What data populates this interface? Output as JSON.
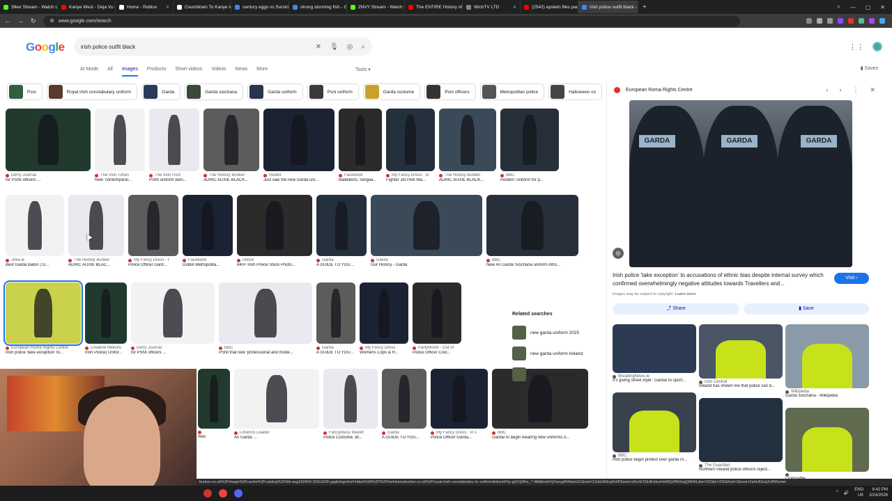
{
  "browser": {
    "tabs": [
      {
        "label": "Slker Stream - Watch Liv",
        "color": "#53fc18"
      },
      {
        "label": "Kanye West - Deja Vu (M",
        "color": "#ff0000"
      },
      {
        "label": "Home - Roblox",
        "color": "#ffffff"
      },
      {
        "label": "Countdown To Kanye We",
        "color": "#ffffff"
      },
      {
        "label": "century eggs vs Surströmi",
        "color": "#4285f4"
      },
      {
        "label": "strong storming fish - Go",
        "color": "#4285f4"
      },
      {
        "label": "2NVY Stream - Watch Liv",
        "color": "#53fc18"
      },
      {
        "label": "The ENTIRE History of Eg",
        "color": "#ff0000"
      },
      {
        "label": "WichTV LTD",
        "color": "#888888"
      },
      {
        "label": "(2542) epstein files paddy",
        "color": "#ff0000"
      },
      {
        "label": "irish police outfit black - ",
        "color": "#4285f4"
      }
    ],
    "new_tab": "+",
    "url": "www.google.com/search"
  },
  "google": {
    "logo": "Google",
    "query": "irish police outfit black",
    "nav_tabs": [
      "AI Mode",
      "All",
      "Images",
      "Products",
      "Short videos",
      "Videos",
      "News",
      "More"
    ],
    "tools": "Tools",
    "saves": "Saves",
    "chips": [
      "Psni",
      "Royal irish constabulary uniform",
      "Garda",
      "Garda siochana",
      "Garda uniform",
      "Psni uniform",
      "Garda costume",
      "Psni officers",
      "Metropolitan police",
      "Halloween co"
    ]
  },
  "results": {
    "row1": [
      {
        "source": "Derry Journal",
        "title": "for PSNI officers ..."
      },
      {
        "source": "The Irish Times",
        "title": "New 'contemporar..."
      },
      {
        "source": "The Irish Post",
        "title": "PSNI uniform bein..."
      },
      {
        "source": "The History Bunker",
        "title": "ADRIC AUXIE BLACK..."
      },
      {
        "source": "Reddit",
        "title": "Just saw the new Garda uni..."
      },
      {
        "source": "Facebook",
        "title": "Bailieboro, Sergea..."
      },
      {
        "source": "My Fancy Dress · In",
        "title": "Fighter Jet Pilot Ma..."
      },
      {
        "source": "The History Bunker",
        "title": "ADRIC AUXIE BLACK..."
      },
      {
        "source": "BBC",
        "title": "modern' uniform for p..."
      }
    ],
    "row2": [
      {
        "source": "Joke.ie",
        "title": "Best Garda Baton | G..."
      },
      {
        "source": "The History Bunker",
        "title": "ADRIC AUXIE BLAC..."
      },
      {
        "source": "My Fancy Dress · I",
        "title": "Police Officer Gard..."
      },
      {
        "source": "Facebook",
        "title": "Dublin Metropolita..."
      },
      {
        "source": "iStock",
        "title": "840+ Irish Police Stock Photo..."
      },
      {
        "source": "Garda",
        "title": "A GUIDE TO YOU..."
      },
      {
        "source": "Garda",
        "title": "Our History - Garda"
      },
      {
        "source": "BBC",
        "title": "New An Garda Síochána uniform intro..."
      }
    ],
    "row3": [
      {
        "source": "European Roma Rights Centre",
        "title": "Irish police 'take exception' to..."
      },
      {
        "source": "Creative Millions",
        "title": "Irish Police) Unifor..."
      },
      {
        "source": "Derry Journal",
        "title": "for PSNI officers ..."
      },
      {
        "source": "BBC",
        "title": "PSNI trial new 'professional and mode..."
      },
      {
        "source": "Garda",
        "title": "A GUIDE TO YOU..."
      },
      {
        "source": "My Fancy Dress",
        "title": "Womens Cops & R..."
      },
      {
        "source": "PartyWorld · Out of",
        "title": "Police Officer Cost..."
      }
    ],
    "row4": [
      {
        "source": "",
        "title": "rbec"
      },
      {
        "source": "Limerick Leader",
        "title": "An Garda ..."
      },
      {
        "source": "Fancydress Wareh",
        "title": "Police Costume, Bl..."
      },
      {
        "source": "Garda",
        "title": "A GUIDE TO YOU..."
      },
      {
        "source": "My Fancy Dress · In s",
        "title": "Police Officer Garda..."
      },
      {
        "source": "BBC",
        "title": "Gardaí to begin wearing new uniforms o..."
      }
    ]
  },
  "related": {
    "heading": "Related searches",
    "items": [
      "new garda uniform 2025",
      "new garda uniform ireland",
      "current garda uniform"
    ]
  },
  "panel": {
    "source": "European Roma Rights Centre",
    "garda_label": "GARDA",
    "caption": "Irish police 'take exception' to accusations of ethnic bias despite internal survey which confirmed overwhelmingly negative attitudes towards Travellers and...",
    "copyright": "Images may be subject to copyright.",
    "learn_more": "Learn more",
    "visit": "Visit",
    "share": "Share",
    "save": "Save",
    "related_images": [
      {
        "source": "BreakingNews.ie",
        "title": "It's giving street style': Gardaí to sport..."
      },
      {
        "source": "Irish Central",
        "title": "Ireland has shown me that police can b..."
      },
      {
        "source": "Wikipedia",
        "title": "Garda Síochána - Wikipedia"
      },
      {
        "source": "BBC",
        "title": "Irish police begin protest over garda ro..."
      },
      {
        "source": "The Guardian",
        "title": "Northern Ireland police officers reject..."
      },
      {
        "source": "",
        "title": "Licensable"
      }
    ]
  },
  "status_url": "bunker.co.uk%2Fimage%2Fcache%2Fcatalog%2Fthb-aug160403-320x320h.jpg&imgrefurl=https%3A%2F%2Fthehistorybunker.co.uk%2Froyal-irish-constabulary-ric-uniform&docid=5y-gOrQAKe_7-M&tbnid=Qrhwyg0N4wmGC&vet=12ahUKEwjXxfD6smm1AxXkTkEAHdusHsMQnPAOegQIRAIL&w=320&h=320&hcb=2&ved=2ahUKEwjXxfD6smm",
  "taskbar": {
    "lang": "ENG",
    "region": "UK",
    "time": "8:42 PM",
    "date": "3/24/2026"
  }
}
